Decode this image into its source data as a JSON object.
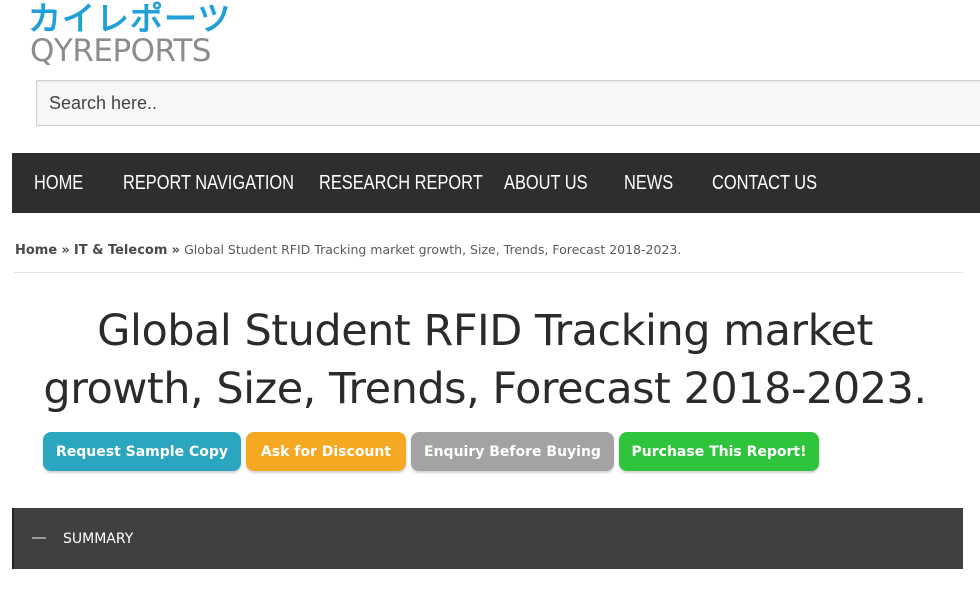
{
  "logo": {
    "japanese": "カイレポーツ",
    "english": "QYREPORTS"
  },
  "search": {
    "placeholder": "Search here.."
  },
  "nav": {
    "items": [
      {
        "label": "HOME"
      },
      {
        "label": "REPORT NAVIGATION"
      },
      {
        "label": "RESEARCH REPORT"
      },
      {
        "label": "ABOUT US"
      },
      {
        "label": "NEWS"
      },
      {
        "label": "CONTACT US"
      }
    ]
  },
  "breadcrumb": {
    "home": "Home",
    "separator": "»",
    "category": "IT & Telecom",
    "current": "Global Student RFID Tracking market growth, Size, Trends, Forecast 2018-2023."
  },
  "page": {
    "title_line1": "Global Student RFID Tracking market",
    "title_line2": "growth, Size, Trends, Forecast 2018-2023."
  },
  "actions": {
    "request_sample": "Request Sample Copy",
    "ask_discount": "Ask for Discount",
    "enquiry": "Enquiry Before Buying",
    "purchase": "Purchase This Report!"
  },
  "summary": {
    "icon": "minus-icon",
    "label": "SUMMARY"
  },
  "colors": {
    "brand_blue": "#1fa0d9",
    "nav_bg": "#2e2e2e",
    "sample_btn": "#2aa7bf",
    "discount_btn": "#f5a821",
    "enquiry_btn": "#a3a3a3",
    "purchase_btn": "#2ec43c",
    "summary_bg": "#404040"
  }
}
